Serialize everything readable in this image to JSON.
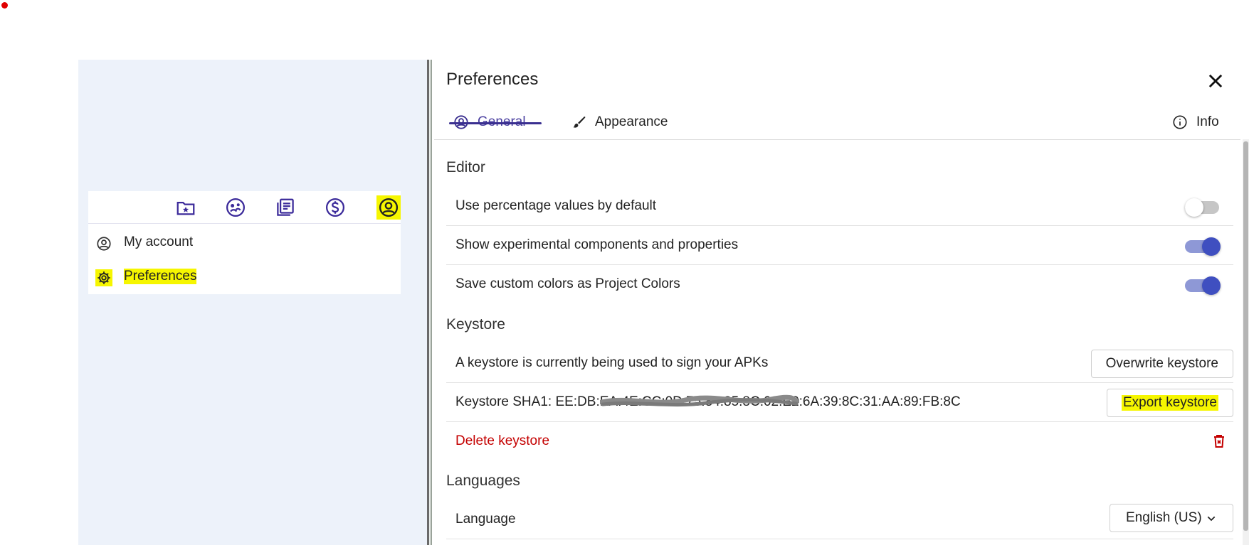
{
  "sidebar": {
    "nav_icons": [
      "project-folder-icon",
      "assets-icon",
      "docs-icon",
      "billing-icon",
      "account-icon"
    ],
    "menu": [
      {
        "label": "My account",
        "icon": "account-circle-icon"
      },
      {
        "label": "Preferences",
        "icon": "gear-icon"
      }
    ]
  },
  "dialog": {
    "title": "Preferences",
    "tabs": {
      "general": "General",
      "appearance": "Appearance",
      "info": "Info"
    }
  },
  "sections": {
    "editor": {
      "title": "Editor",
      "rows": [
        {
          "label": "Use percentage values by default",
          "enabled": false
        },
        {
          "label": "Show experimental components and properties",
          "enabled": true
        },
        {
          "label": "Save custom colors as Project Colors",
          "enabled": true
        }
      ]
    },
    "keystore": {
      "title": "Keystore",
      "status": "A keystore is currently being used to sign your APKs",
      "overwrite_label": "Overwrite keystore",
      "sha1_text": "Keystore SHA1: EE:DB:EA:4E:CC:0D:75:84:85:8C:02:E2:6A:39:8C:31:AA:89:FB:8C",
      "export_label": "Export keystore",
      "delete_label": "Delete keystore"
    },
    "languages": {
      "title": "Languages",
      "label": "Language",
      "selected": "English (US)"
    }
  },
  "colors": {
    "accent": "#3f4fc0",
    "nav_icon": "#3b2a9a",
    "highlight": "#f6f600",
    "danger": "#c40000",
    "left_bg": "#edf2fa"
  }
}
